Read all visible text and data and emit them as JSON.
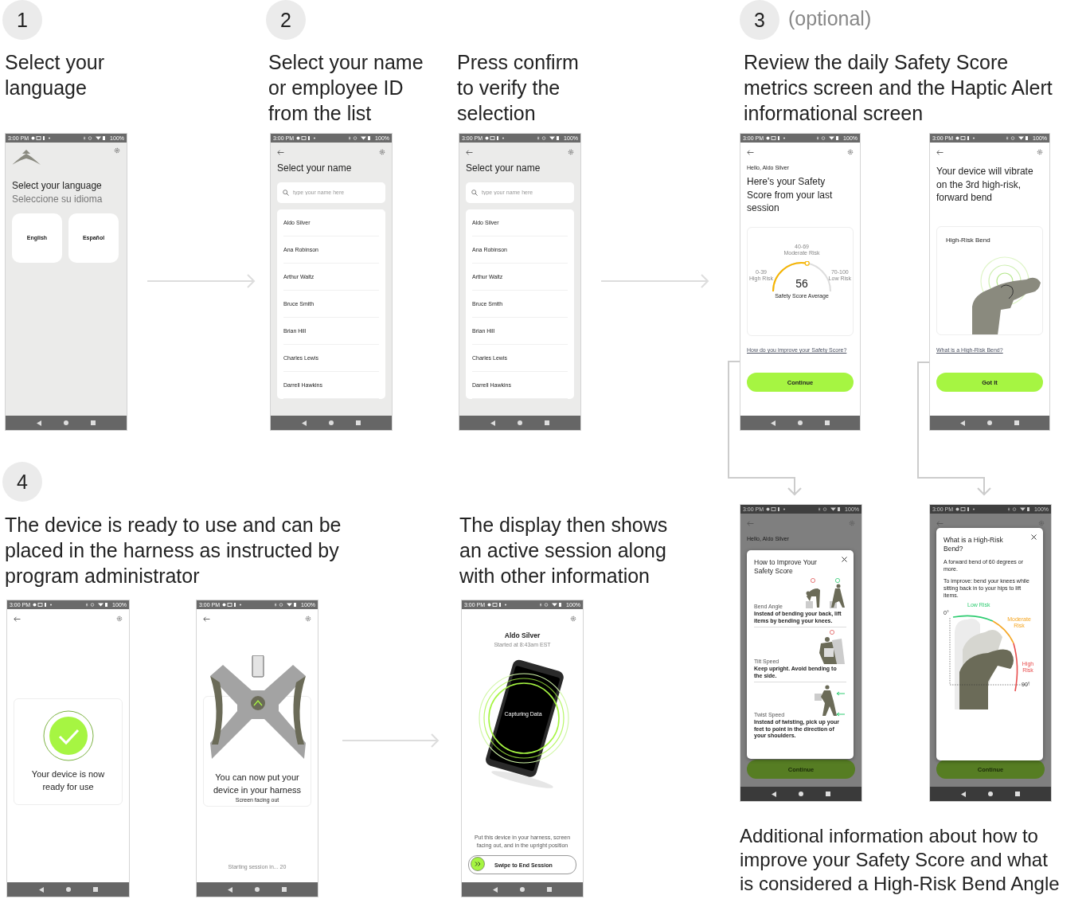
{
  "step_badges": [
    {
      "number": "1"
    },
    {
      "number": "2"
    },
    {
      "number": "3",
      "note": "(optional)"
    },
    {
      "number": "4"
    }
  ],
  "captions": [
    "Select your\nlanguage",
    "Select your name\nor employee ID\nfrom the list",
    "Press confirm\nto verify the\nselection",
    "Review the daily Safety Score\nmetrics screen and the Haptic Alert\ninformational screen",
    "The device is ready to use and can be\nplaced in the harness as instructed by\nprogram administrator",
    "The display then shows\nan active session along\nwith other information",
    "Additional information about how to\nimprove your Safety Score and what\nis considered a High-Risk Bend Angle"
  ],
  "screens": [
    {
      "kind": "language",
      "status_bar": {
        "time": "3:00 PM",
        "battery": "100%"
      },
      "title": "Select your language",
      "subtitle": "Seleccione su idioma",
      "options": [
        "English",
        "Español"
      ]
    },
    {
      "kind": "name_list",
      "status_bar": {
        "time": "3:00 PM",
        "battery": "100%"
      },
      "title": "Select your name",
      "search": {
        "placeholder": "type your name here"
      },
      "names": [
        "Aldo Silver",
        "Ana Robinson",
        "Arthur Waltz",
        "Bruce Smith",
        "Brian Hill",
        "Charles Lewis",
        "Darrell Hawkins"
      ]
    },
    {
      "kind": "name_list",
      "status_bar": {
        "time": "3:00 PM",
        "battery": "100%"
      },
      "title": "Select your name",
      "search": {
        "placeholder": "type your name here"
      },
      "names": [
        "Aldo Silver",
        "Ana Robinson",
        "Arthur Waltz",
        "Bruce Smith",
        "Brian Hill",
        "Charles Lewis",
        "Darrell Hawkins"
      ]
    },
    {
      "kind": "safety_score",
      "status_bar": {
        "time": "3:00 PM",
        "battery": "100%"
      },
      "greeting": "Hello, Aldo Silver",
      "heading": "Here's your Safety Score from your last session",
      "gauge": {
        "level": 0.56,
        "score": "56",
        "caption": "Safety Score Average",
        "zones": [
          {
            "range": "0-39",
            "label": "High Risk"
          },
          {
            "range": "40-69",
            "label": "Moderate Risk"
          },
          {
            "range": "70-100",
            "label": "Low Risk"
          }
        ]
      },
      "link": "How do you improve your Safety Score?",
      "button": "Continue"
    },
    {
      "kind": "haptic_alert",
      "status_bar": {
        "time": "3:00 PM",
        "battery": "100%"
      },
      "heading": "Your device will vibrate on the 3rd high-risk, forward bend",
      "card_title": "High-Risk Bend",
      "link": "What is a High-Risk Bend?",
      "button": "Got It"
    },
    {
      "kind": "improve_popup",
      "status_bar": {
        "time": "3:00 PM",
        "battery": "100%"
      },
      "greeting": "Hello, Aldo Silver",
      "popup": {
        "title": "How to Improve Your Safety Score",
        "tips": [
          {
            "title": "Bend Angle",
            "text": "Instead of bending your back, lift items by bending your knees."
          },
          {
            "title": "Tilt Speed",
            "text": "Keep upright. Avoid bending to the side."
          },
          {
            "title": "Twist Speed",
            "text": "Instead of twisting, pick up your feet to point in the direction of your shoulders."
          }
        ]
      },
      "button": "Continue"
    },
    {
      "kind": "high_risk_popup",
      "status_bar": {
        "time": "3:00 PM",
        "battery": "100%"
      },
      "popup": {
        "title": "What is a High-Risk Bend?",
        "paragraphs": [
          "A forward bend of 60 degrees or more.",
          "To improve: bend your knees while sitting back in to your hips to lift items."
        ],
        "zones": [
          {
            "label": "Low Risk",
            "color": "#2ecc71"
          },
          {
            "label": "Moderate Risk",
            "color": "#f5a623"
          },
          {
            "label": "High Risk",
            "color": "#e84c4c"
          }
        ],
        "angles": [
          "0°",
          "90°"
        ]
      },
      "button": "Continue"
    },
    {
      "kind": "ready",
      "status_bar": {
        "time": "3:00 PM",
        "battery": "100%"
      },
      "message": "Your device is now ready for use"
    },
    {
      "kind": "harness",
      "status_bar": {
        "time": "3:00 PM",
        "battery": "100%"
      },
      "message": "You can now put your device in your harness",
      "hint": "Screen facing out",
      "countdown": "Starting session in... 20"
    },
    {
      "kind": "session",
      "status_bar": {
        "time": "3:00 PM",
        "battery": "100%"
      },
      "name": "Aldo Silver",
      "started": "Started at 8:43am EST",
      "capture": "Capturing Data",
      "instruction": "Put this device in your harness, screen facing out, and in the upright position",
      "swipe": {
        "label": "Swipe to End Session",
        "level": 0
      }
    }
  ]
}
